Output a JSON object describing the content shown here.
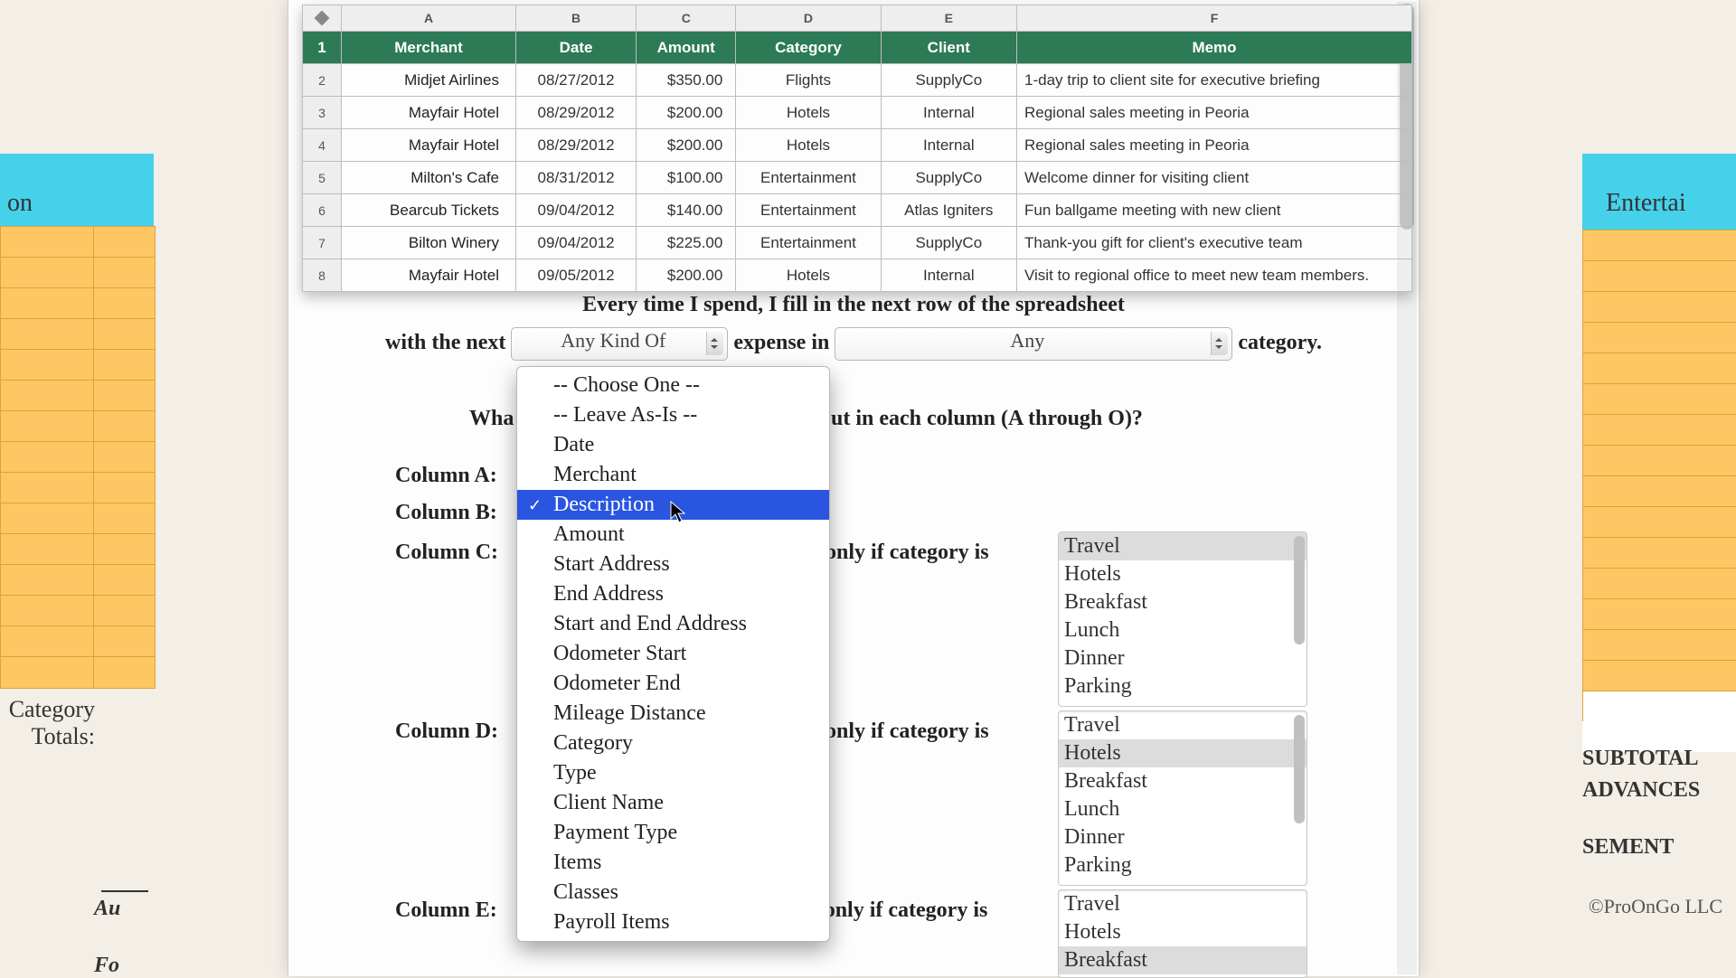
{
  "bg": {
    "left_header_frag": "on",
    "right_header_frag": "Entertai",
    "cat_totals_l1": "Category",
    "cat_totals_l2": "Totals:",
    "subtotal": "SUBTOTAL",
    "advances": "ADVANCES",
    "sement": "SEMENT",
    "au": "Au",
    "fo": "Fo",
    "copyright": "©ProOnGo LLC"
  },
  "sheet": {
    "col_letters": [
      "A",
      "B",
      "C",
      "D",
      "E",
      "F"
    ],
    "headers": [
      "Merchant",
      "Date",
      "Amount",
      "Category",
      "Client",
      "Memo"
    ],
    "rows": [
      {
        "n": "1"
      },
      {
        "n": "2",
        "m": "Midjet Airlines",
        "d": "08/27/2012",
        "a": "$350.00",
        "c": "Flights",
        "cl": "SupplyCo",
        "memo": "1-day trip to client site for executive briefing"
      },
      {
        "n": "3",
        "m": "Mayfair Hotel",
        "d": "08/29/2012",
        "a": "$200.00",
        "c": "Hotels",
        "cl": "Internal",
        "memo": "Regional sales meeting in Peoria"
      },
      {
        "n": "4",
        "m": "Mayfair Hotel",
        "d": "08/29/2012",
        "a": "$200.00",
        "c": "Hotels",
        "cl": "Internal",
        "memo": "Regional sales meeting in Peoria"
      },
      {
        "n": "5",
        "m": "Milton's Cafe",
        "d": "08/31/2012",
        "a": "$100.00",
        "c": "Entertainment",
        "cl": "SupplyCo",
        "memo": "Welcome dinner for visiting client"
      },
      {
        "n": "6",
        "m": "Bearcub Tickets",
        "d": "09/04/2012",
        "a": "$140.00",
        "c": "Entertainment",
        "cl": "Atlas Igniters",
        "memo": "Fun ballgame meeting with new client"
      },
      {
        "n": "7",
        "m": "Bilton Winery",
        "d": "09/04/2012",
        "a": "$225.00",
        "c": "Entertainment",
        "cl": "SupplyCo",
        "memo": "Thank-you gift for client's executive team"
      },
      {
        "n": "8",
        "m": "Mayfair Hotel",
        "d": "09/05/2012",
        "a": "$200.00",
        "c": "Hotels",
        "cl": "Internal",
        "memo": "Visit to regional office to meet new team members."
      }
    ]
  },
  "narr_line1": "Every time I spend, I fill in the next row of the spreadsheet",
  "narr_with_the_next": "with the next",
  "narr_expense_in": "expense in",
  "narr_category": "category.",
  "sel_kind": "Any Kind Of",
  "sel_cat": "Any",
  "question_full": "What expense information do you put in each column (A through O)?",
  "question_left": "Wha",
  "question_right": "ut in each column (A through O)?",
  "col_labels": {
    "A": "Column A:",
    "B": "Column B:",
    "C": "Column C:",
    "D": "Column D:",
    "E": "Column E:"
  },
  "only_if": "only if category is",
  "menu_items": [
    "-- Choose One --",
    "-- Leave As-Is --",
    "Date",
    "Merchant",
    "Description",
    "Amount",
    "Start Address",
    "End Address",
    "Start and End Address",
    "Odometer Start",
    "Odometer End",
    "Mileage Distance",
    "Category",
    "Type",
    "Client Name",
    "Payment Type",
    "Items",
    "Classes",
    "Payroll Items"
  ],
  "menu_selected": "Description",
  "listbox1": {
    "items": [
      "Travel",
      "Hotels",
      "Breakfast",
      "Lunch",
      "Dinner",
      "Parking"
    ],
    "selected": [
      "Travel"
    ]
  },
  "listbox2": {
    "items": [
      "Travel",
      "Hotels",
      "Breakfast",
      "Lunch",
      "Dinner",
      "Parking"
    ],
    "selected": [
      "Hotels"
    ]
  },
  "listbox3": {
    "items": [
      "Travel",
      "Hotels",
      "Breakfast"
    ],
    "selected": [
      "Breakfast"
    ]
  }
}
